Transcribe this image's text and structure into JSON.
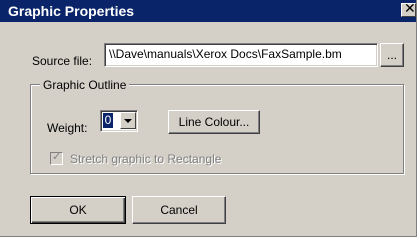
{
  "window": {
    "title": "Graphic Properties",
    "close_glyph": "✕"
  },
  "source": {
    "label": "Source file:",
    "value": "\\\\Dave\\manuals\\Xerox Docs\\FaxSample.bm",
    "browse_label": "..."
  },
  "outline": {
    "legend": "Graphic Outline",
    "weight_label": "Weight:",
    "weight_value": "0",
    "line_colour_label": "Line Colour...",
    "stretch_label": "Stretch graphic to Rectangle",
    "stretch_checked": true,
    "stretch_check_glyph": "✓"
  },
  "buttons": {
    "ok": "OK",
    "cancel": "Cancel"
  }
}
